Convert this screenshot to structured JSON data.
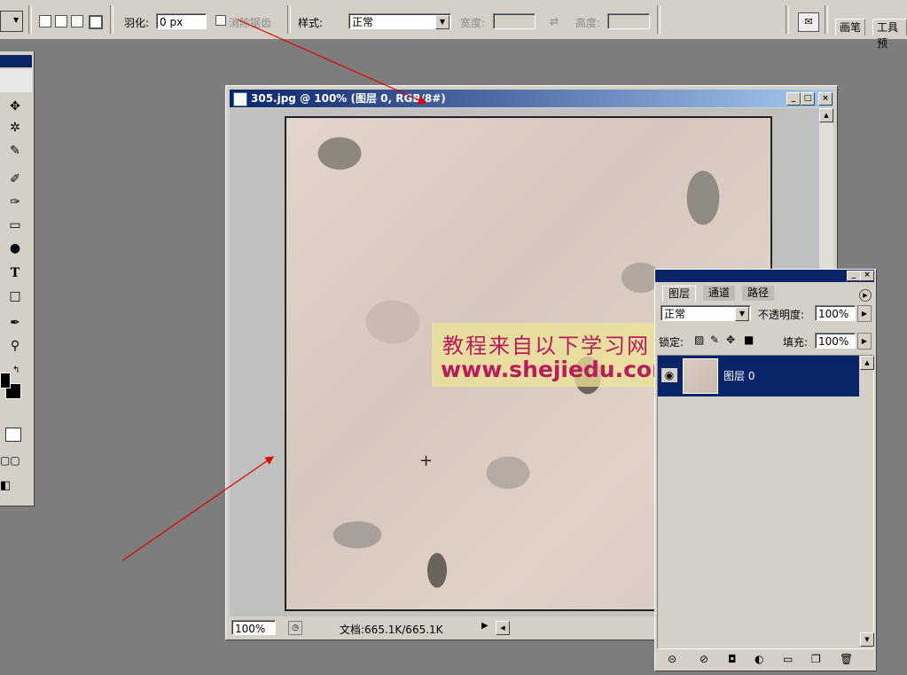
{
  "options_bar": {
    "feather_label": "羽化:",
    "feather_value": "0 px",
    "antialias_label": "消除锯齿",
    "style_label": "样式:",
    "style_value": "正常",
    "width_label": "宽度:",
    "height_label": "高度:",
    "tabs": [
      "画笔",
      "工具预"
    ]
  },
  "document": {
    "title": "305.jpg @ 100% (图层 0, RGB/8#)",
    "zoom": "100%",
    "doc_info": "文档:665.1K/665.1K",
    "watermark_line1": "教程来自以下学习网",
    "watermark_line2": "www.shejiedu.com"
  },
  "layers_panel": {
    "tabs": [
      "图层",
      "通道",
      "路径"
    ],
    "blend_mode": "正常",
    "opacity_label": "不透明度:",
    "opacity_value": "100%",
    "lock_label": "锁定:",
    "fill_label": "填充:",
    "fill_value": "100%",
    "layers": [
      {
        "name": "图层 0",
        "selected": true
      }
    ]
  },
  "colors": {
    "workspace": "#7d7d7d",
    "chrome": "#d4d0c8",
    "selection": "#0a246a",
    "watermark_text": "#b81c5c",
    "annotation_arrow": "#e00000"
  },
  "tools": [
    "move-icon",
    "magic-wand-icon",
    "healing-brush-icon",
    "brush-icon",
    "history-brush-icon",
    "gradient-icon",
    "burn-icon",
    "type-icon",
    "shape-icon",
    "eyedropper-icon",
    "zoom-icon"
  ]
}
